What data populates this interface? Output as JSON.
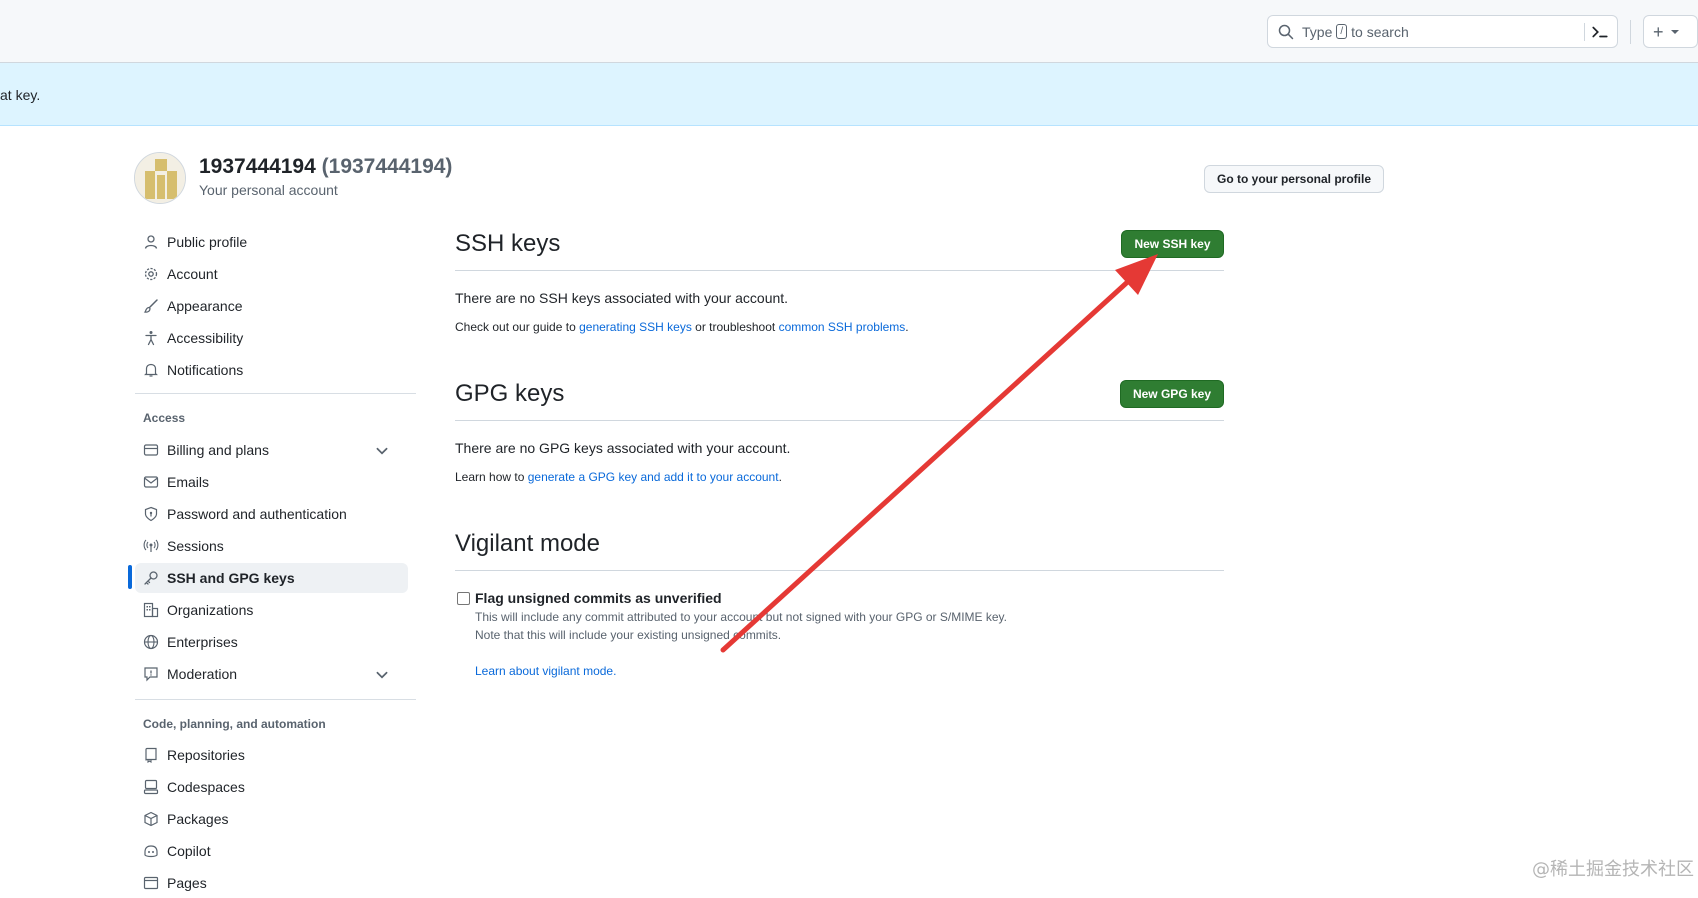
{
  "header": {
    "search": {
      "prefix": "Type",
      "key": "/",
      "suffix": "to search"
    },
    "plus_label": "+"
  },
  "flash": {
    "text": "at key."
  },
  "profile": {
    "username": "1937444194",
    "display_name": "(1937444194)",
    "subtitle": "Your personal account",
    "go_profile_label": "Go to your personal profile"
  },
  "sidebar": {
    "items_top": [
      {
        "label": "Public profile",
        "icon": "person-icon"
      },
      {
        "label": "Account",
        "icon": "gear-icon"
      },
      {
        "label": "Appearance",
        "icon": "paintbrush-icon"
      },
      {
        "label": "Accessibility",
        "icon": "accessibility-icon"
      },
      {
        "label": "Notifications",
        "icon": "bell-icon"
      }
    ],
    "access_heading": "Access",
    "items_access": [
      {
        "label": "Billing and plans",
        "icon": "credit-card-icon"
      },
      {
        "label": "Emails",
        "icon": "mail-icon"
      },
      {
        "label": "Password and authentication",
        "icon": "shield-lock-icon"
      },
      {
        "label": "Sessions",
        "icon": "broadcast-icon"
      },
      {
        "label": "SSH and GPG keys",
        "icon": "key-icon"
      },
      {
        "label": "Organizations",
        "icon": "organization-icon"
      },
      {
        "label": "Enterprises",
        "icon": "globe-icon"
      },
      {
        "label": "Moderation",
        "icon": "report-icon"
      }
    ],
    "code_heading": "Code, planning, and automation",
    "items_code": [
      {
        "label": "Repositories",
        "icon": "repo-icon"
      },
      {
        "label": "Codespaces",
        "icon": "codespaces-icon"
      },
      {
        "label": "Packages",
        "icon": "package-icon"
      },
      {
        "label": "Copilot",
        "icon": "copilot-icon"
      },
      {
        "label": "Pages",
        "icon": "browser-icon"
      }
    ]
  },
  "main": {
    "ssh": {
      "title": "SSH keys",
      "button": "New SSH key",
      "empty": "There are no SSH keys associated with your account.",
      "guide_prefix": "Check out our guide to",
      "guide_link": "generating SSH keys",
      "guide_middle": "or troubleshoot",
      "guide_link2": "common SSH problems",
      "guide_end": "."
    },
    "gpg": {
      "title": "GPG keys",
      "button": "New GPG key",
      "empty": "There are no GPG keys associated with your account.",
      "learn_prefix": "Learn how to",
      "learn_link": "generate a GPG key and add it to your account",
      "learn_end": "."
    },
    "vigilant": {
      "title": "Vigilant mode",
      "checkbox_label": "Flag unsigned commits as unverified",
      "note1": "This will include any commit attributed to your account but not signed with your GPG or S/MIME key.",
      "note2": "Note that this will include your existing unsigned commits.",
      "learn_link": "Learn about vigilant mode."
    }
  },
  "watermark": "@稀土掘金技术社区",
  "colors": {
    "accent": "#0969da",
    "primary_button": "#2f7d32",
    "arrow": "#e53935"
  }
}
